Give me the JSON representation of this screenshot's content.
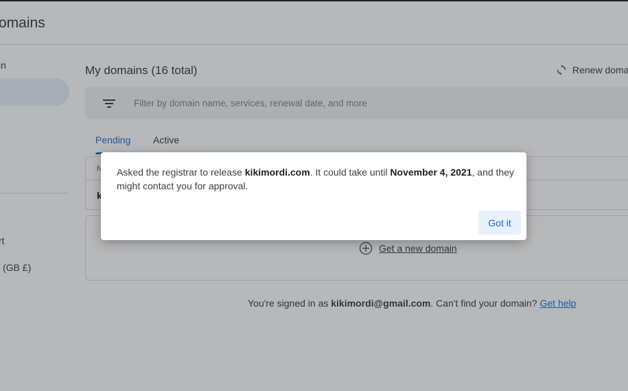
{
  "app": {
    "title": "omains"
  },
  "sidebar": {
    "items": [
      {
        "label": "in"
      },
      {
        "label": "rt"
      },
      {
        "label": "(GB £)"
      }
    ]
  },
  "main": {
    "title": "My domains (16 total)",
    "renew_label": "Renew doma",
    "filter_placeholder": "Filter by domain name, services, renewal date, and more",
    "tabs": [
      {
        "label": "Pending",
        "selected": true
      },
      {
        "label": "Active",
        "selected": false
      }
    ],
    "table": {
      "header_first": "N",
      "rows": [
        {
          "first": "k"
        }
      ]
    },
    "get_new_domain": "Get a new domain"
  },
  "footer": {
    "prefix": "You're signed in as ",
    "email": "kikimordi@gmail.com",
    "middle": ". Can't find your domain? ",
    "help_link": "Get help"
  },
  "dialog": {
    "msg_part1": "Asked the registrar to release ",
    "msg_domain": "kikimordi.com",
    "msg_part2": ". It could take until ",
    "msg_date": "November 4, 2021",
    "msg_part3": ", and they might contact you for approval.",
    "button_label": "Got it"
  },
  "colors": {
    "accent": "#1a73e8",
    "button_bg": "#e8f0fe",
    "scrim": "rgba(32,33,36,0.32)"
  }
}
